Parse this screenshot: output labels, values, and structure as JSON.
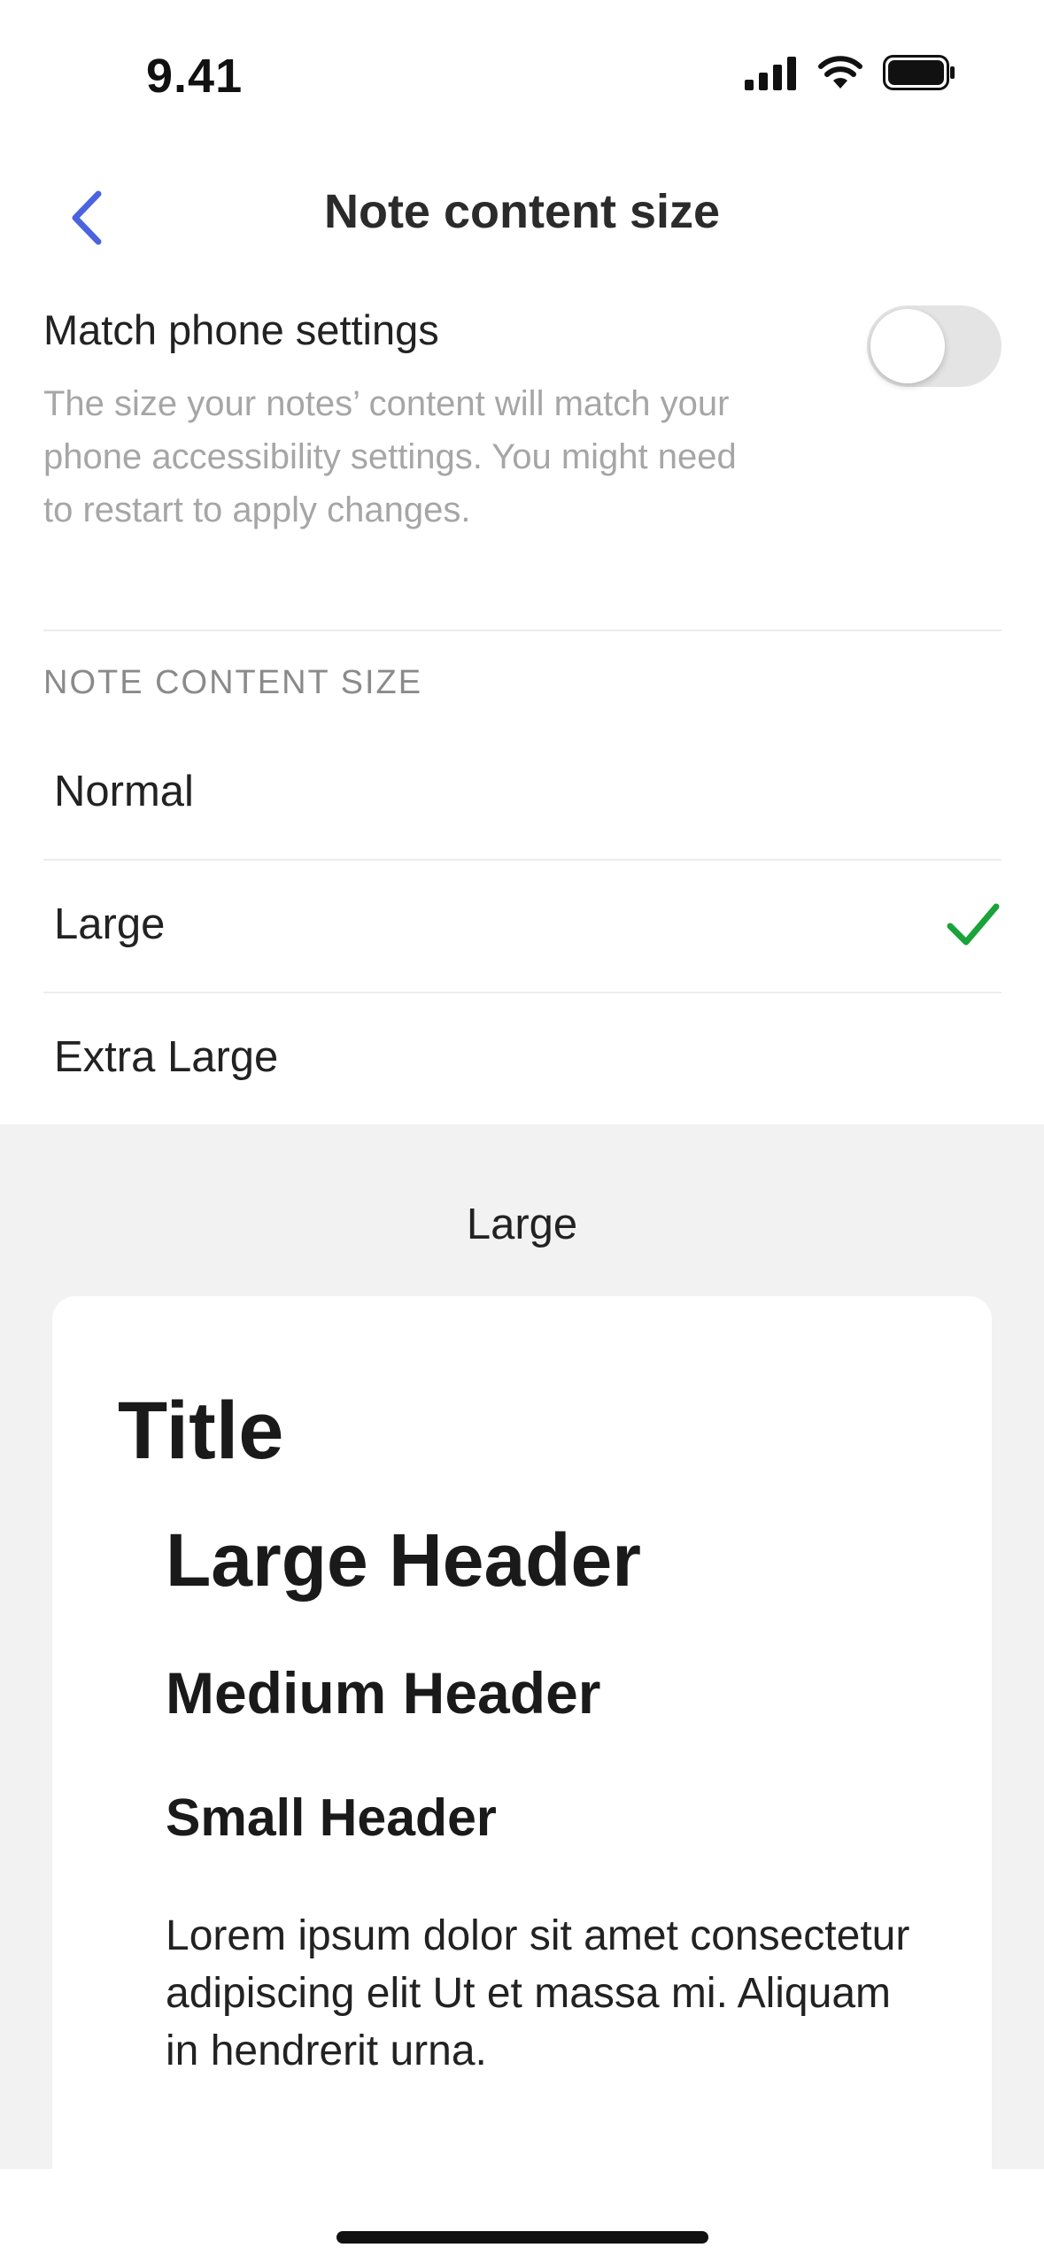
{
  "status_bar": {
    "time": "9.41",
    "icons": [
      "cellular-signal-icon",
      "wifi-icon",
      "battery-icon"
    ]
  },
  "nav": {
    "back_icon": "chevron-left-icon",
    "title": "Note content size"
  },
  "match_phone": {
    "title": "Match phone settings",
    "description": "The size your notes’ content will match your phone accessibility settings. You might need to restart to apply changes.",
    "toggle_on": false
  },
  "section": {
    "header": "NOTE CONTENT SIZE"
  },
  "size_options": [
    {
      "label": "Normal",
      "selected": false
    },
    {
      "label": "Large",
      "selected": true
    },
    {
      "label": "Extra Large",
      "selected": false
    }
  ],
  "preview": {
    "label": "Large",
    "title": "Title",
    "large_header": "Large Header",
    "medium_header": "Medium Header",
    "small_header": "Small Header",
    "body": "Lorem ipsum dolor sit amet consectetur adipiscing elit Ut et massa mi. Aliquam in hendrerit urna."
  },
  "colors": {
    "accent": "#4a63e0",
    "check": "#1aa33a",
    "toggle_off": "#e4e4e4",
    "preview_bg": "#f2f2f2"
  }
}
